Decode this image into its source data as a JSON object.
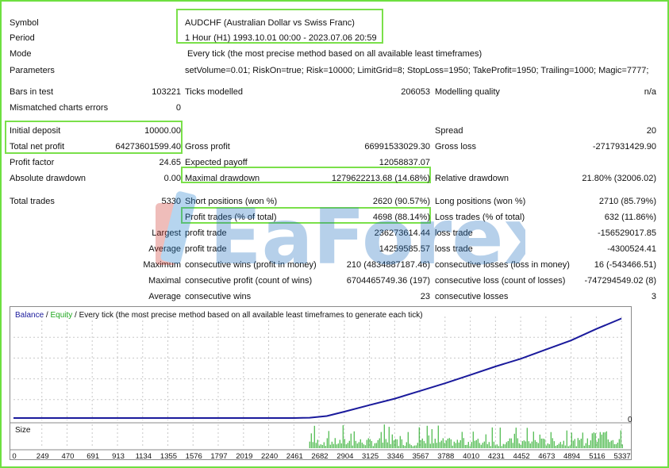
{
  "report": {
    "symbol": {
      "label": "Symbol",
      "value": "AUDCHF (Australian Dollar vs Swiss Franc)"
    },
    "period": {
      "label": "Period",
      "value": "1 Hour (H1) 1993.10.01 00:00 - 2023.07.06 20:59"
    },
    "mode": {
      "label": "Mode",
      "value": "Every tick (the most precise method based on all available least timeframes)"
    },
    "parameters": {
      "label": "Parameters",
      "value": "setVolume=0.01; RiskOn=true; Risk=10000; LimitGrid=8; StopLoss=1950; TakeProfit=1950; Trailing=1000; Magic=7777;"
    },
    "bars_in_test": {
      "label": "Bars in test",
      "value": "103221"
    },
    "ticks_modelled": {
      "label": "Ticks modelled",
      "value": "206053"
    },
    "modelling_quality": {
      "label": "Modelling quality",
      "value": "n/a"
    },
    "mismatched_errors": {
      "label": "Mismatched charts errors",
      "value": "0"
    },
    "initial_deposit": {
      "label": "Initial deposit",
      "value": "10000.00"
    },
    "spread": {
      "label": "Spread",
      "value": "20"
    },
    "total_net_profit": {
      "label": "Total net profit",
      "value": "64273601599.40"
    },
    "gross_profit": {
      "label": "Gross profit",
      "value": "66991533029.30"
    },
    "gross_loss": {
      "label": "Gross loss",
      "value": "-2717931429.90"
    },
    "profit_factor": {
      "label": "Profit factor",
      "value": "24.65"
    },
    "expected_payoff": {
      "label": "Expected payoff",
      "value": "12058837.07"
    },
    "absolute_drawdown": {
      "label": "Absolute drawdown",
      "value": "0.00"
    },
    "maximal_drawdown": {
      "label": "Maximal drawdown",
      "value": "1279622213.68 (14.68%)"
    },
    "relative_drawdown": {
      "label": "Relative drawdown",
      "value": "21.80% (32006.02)"
    },
    "total_trades": {
      "label": "Total trades",
      "value": "5330"
    },
    "short_positions": {
      "label": "Short positions (won %)",
      "value": "2620 (90.57%)"
    },
    "long_positions": {
      "label": "Long positions (won %)",
      "value": "2710 (85.79%)"
    },
    "profit_trades": {
      "label": "Profit trades (% of total)",
      "value": "4698 (88.14%)"
    },
    "loss_trades": {
      "label": "Loss trades (% of total)",
      "value": "632 (11.86%)"
    },
    "largest": {
      "label": "Largest",
      "profit_label": "profit trade",
      "profit_value": "236273614.44",
      "loss_label": "loss trade",
      "loss_value": "-156529017.85"
    },
    "average": {
      "label": "Average",
      "profit_label": "profit trade",
      "profit_value": "14259585.57",
      "loss_label": "loss trade",
      "loss_value": "-4300524.41"
    },
    "maximum": {
      "label": "Maximum",
      "wins_label": "consecutive wins (profit in money)",
      "wins_value": "210 (4834887187.46)",
      "losses_label": "consecutive losses (loss in money)",
      "losses_value": "16 (-543466.51)"
    },
    "maximal": {
      "label": "Maximal",
      "wins_label": "consecutive profit (count of wins)",
      "wins_value": "6704465749.36 (197)",
      "losses_label": "consecutive loss (count of losses)",
      "losses_value": "-747294549.02 (8)"
    },
    "average_consec": {
      "label": "Average",
      "wins_label": "consecutive wins",
      "wins_value": "23",
      "losses_label": "consecutive losses",
      "losses_value": "3"
    }
  },
  "watermark": {
    "text": "EaForex"
  },
  "chart": {
    "legend_balance": "Balance",
    "legend_sep": " / ",
    "legend_equity": "Equity",
    "legend_rest": " / Every tick (the most precise method based on all available least timeframes to generate each tick)",
    "size_label": "Size",
    "zero_label": "0",
    "colors": {
      "balance": "#1a1a9c",
      "volume": "#1fa81f",
      "grid": "#c8c8c8",
      "highlight": "#7ae04a",
      "equity_legend": "#1fa81f",
      "balance_legend": "#1a1a9c"
    }
  },
  "chart_data": {
    "type": "line",
    "series": [
      {
        "name": "Balance",
        "x": [
          0,
          2461,
          2600,
          2750,
          2904,
          3125,
          3346,
          3567,
          3788,
          4010,
          4231,
          4452,
          4673,
          4894,
          5116,
          5337
        ],
        "values": [
          0,
          0,
          0.2,
          1.2,
          3.9,
          7.9,
          11.8,
          16.5,
          21.2,
          26.3,
          31.5,
          36.2,
          41.8,
          47.4,
          54.4,
          60.8
        ]
      }
    ],
    "x_ticks": [
      "0",
      "249",
      "470",
      "691",
      "913",
      "1134",
      "1355",
      "1576",
      "1797",
      "2019",
      "2240",
      "2461",
      "2682",
      "2904",
      "3125",
      "3346",
      "3567",
      "3788",
      "4010",
      "4231",
      "4452",
      "4673",
      "4894",
      "5116",
      "5337"
    ],
    "xlim": [
      0,
      5350
    ],
    "y_zero_label": "0",
    "volume": {
      "start_trade": 2600,
      "end_trade": 5350
    }
  }
}
